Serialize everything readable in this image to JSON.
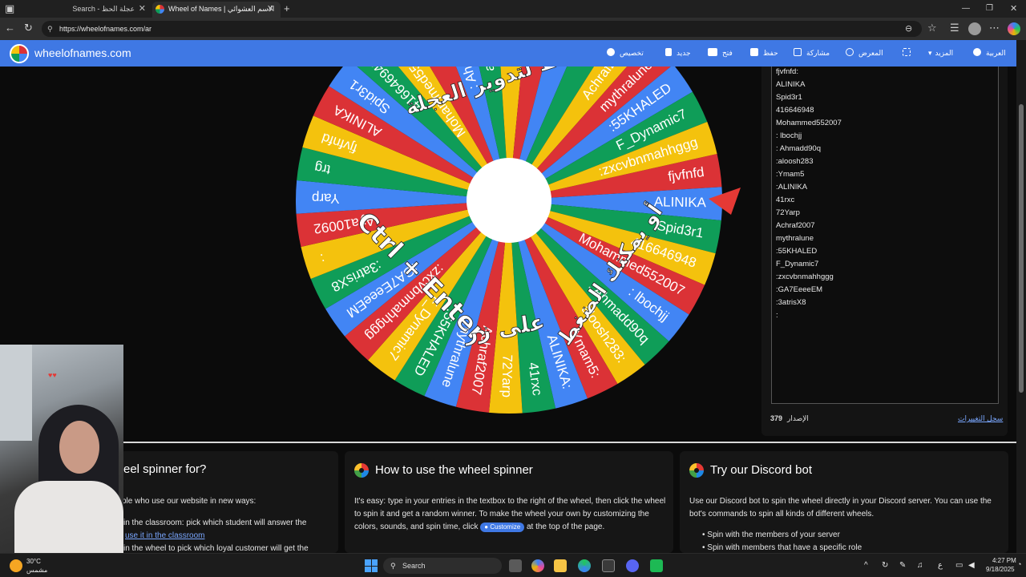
{
  "browser": {
    "tabs": [
      {
        "label": "Search - عجلة الحظ",
        "active": false
      },
      {
        "label": "Wheel of Names | الاسم العشوائي",
        "active": true
      }
    ],
    "url": "https://wheelofnames.com/ar"
  },
  "site": {
    "logo": "wheelofnames.com",
    "nav": {
      "customize": "تخصيص",
      "new": "جديد",
      "open": "فتح",
      "save": "حفظ",
      "share": "مشاركة",
      "gallery": "المعرض",
      "more": "المزيد",
      "language": "العربية"
    },
    "colors": {
      "nav": "#3f78e4",
      "red": "#db3236",
      "blue": "#4285f4",
      "green": "#0f9d58",
      "yellow": "#f4c20d"
    }
  },
  "wheel": {
    "segments": [
      "fjvfnfd",
      "ALINIKA",
      "Spid3r1",
      "416646948",
      "Mohammed552007",
      ": lbochjj",
      ": Ahmadd90q",
      "aloosh283:",
      "Ymam5:",
      "ALINIKA:",
      "41rxc",
      "72Yarp",
      "Achraf2007",
      "mythralune",
      ":55KHALED",
      "F_Dynamic7",
      ":zxcvbnmahhggg",
      ":GA7EeeeEM",
      ":3atrisX8",
      ":",
      "Aya10092",
      "Yarp",
      "trg"
    ],
    "overlay_top": "اضغط لتدوير العجلة",
    "overlay_ctrl": "Ctrl + Enter",
    "overlay_press": "على زر",
    "overlay_can": "أو يمكنك الضغط"
  },
  "entries": {
    "items": [
      "fjvfnfd:",
      "ALINIKA",
      "Spid3r1",
      "416646948",
      "Mohammed552007",
      ": lbochjj",
      ": Ahmadd90q",
      ":aloosh283",
      ":Ymam5",
      ":ALINIKA",
      "41rxc",
      "72Yarp",
      "Achraf2007",
      "mythralune",
      ":55KHALED",
      "F_Dynamic7",
      ":zxcvbnmahhggg",
      ":GA7EeeeEM",
      ":3atrisX8",
      ":"
    ],
    "version_label": "الإصدار",
    "version_number": "379",
    "changelog": "سجل التغييرات"
  },
  "cards": [
    {
      "title": "eel spinner for?",
      "text1": "ple who use our website in new ways:",
      "text2": "in the classroom: pick which student will answer the",
      "link": "use it in the classroom",
      "text3": "in the wheel to pick which loyal customer will get the"
    },
    {
      "title": "How to use the wheel spinner",
      "text": "It's easy: type in your entries in the textbox to the right of the wheel, then click the wheel to spin it and get a random winner. To make the wheel your own by customizing the colors, sounds, and spin time, click",
      "chip": "Customize",
      "text_after": "at the top of the page."
    },
    {
      "title": "Try our Discord bot",
      "text": "Use our Discord bot to spin the wheel directly in your Discord server. You can use the bot's commands to spin all kinds of different wheels.",
      "bullets": [
        "Spin with the members of your server",
        "Spin with members that have a specific role"
      ]
    }
  ],
  "taskbar": {
    "weather_temp": "30°C",
    "weather_desc": "مشمس",
    "search": "Search",
    "lang": "ع",
    "time": "4:27 PM",
    "date": "9/18/2025"
  }
}
